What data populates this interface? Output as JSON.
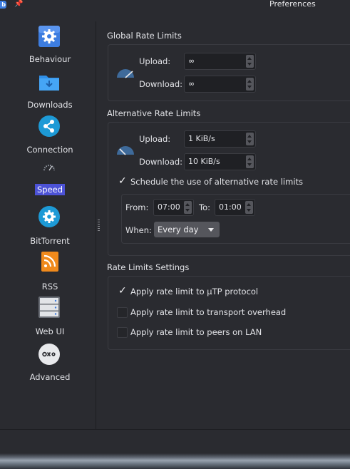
{
  "window": {
    "title": "Preferences",
    "app_icon_text": "b"
  },
  "sidebar": {
    "items": [
      {
        "label": "Behaviour",
        "icon": "gear-icon"
      },
      {
        "label": "Downloads",
        "icon": "folder-download-icon"
      },
      {
        "label": "Connection",
        "icon": "share-icon"
      },
      {
        "label": "Speed",
        "icon": "speedometer-icon",
        "selected": true
      },
      {
        "label": "BitTorrent",
        "icon": "gear-icon"
      },
      {
        "label": "RSS",
        "icon": "rss-icon"
      },
      {
        "label": "Web UI",
        "icon": "server-icon"
      },
      {
        "label": "Advanced",
        "icon": "advanced-icon"
      }
    ]
  },
  "global": {
    "title": "Global Rate Limits",
    "upload_label": "Upload:",
    "upload_value": "∞",
    "download_label": "Download:",
    "download_value": "∞"
  },
  "alternative": {
    "title": "Alternative Rate Limits",
    "upload_label": "Upload:",
    "upload_value": "1 KiB/s",
    "download_label": "Download:",
    "download_value": "10 KiB/s",
    "schedule_label": "Schedule the use of alternative rate limits",
    "schedule_checked": true,
    "from_label": "From:",
    "from_value": "07:00",
    "to_label": "To:",
    "to_value": "01:00",
    "when_label": "When:",
    "when_value": "Every day"
  },
  "settings": {
    "title": "Rate Limits Settings",
    "options": [
      {
        "label": "Apply rate limit to µTP protocol",
        "checked": true
      },
      {
        "label": "Apply rate limit to transport overhead",
        "checked": false
      },
      {
        "label": "Apply rate limit to peers on LAN",
        "checked": false
      }
    ]
  },
  "colors": {
    "background": "#2a2b30",
    "selection": "#4c52d6",
    "accent_blue": "#3d7de0",
    "rss_orange": "#f08a1c"
  }
}
